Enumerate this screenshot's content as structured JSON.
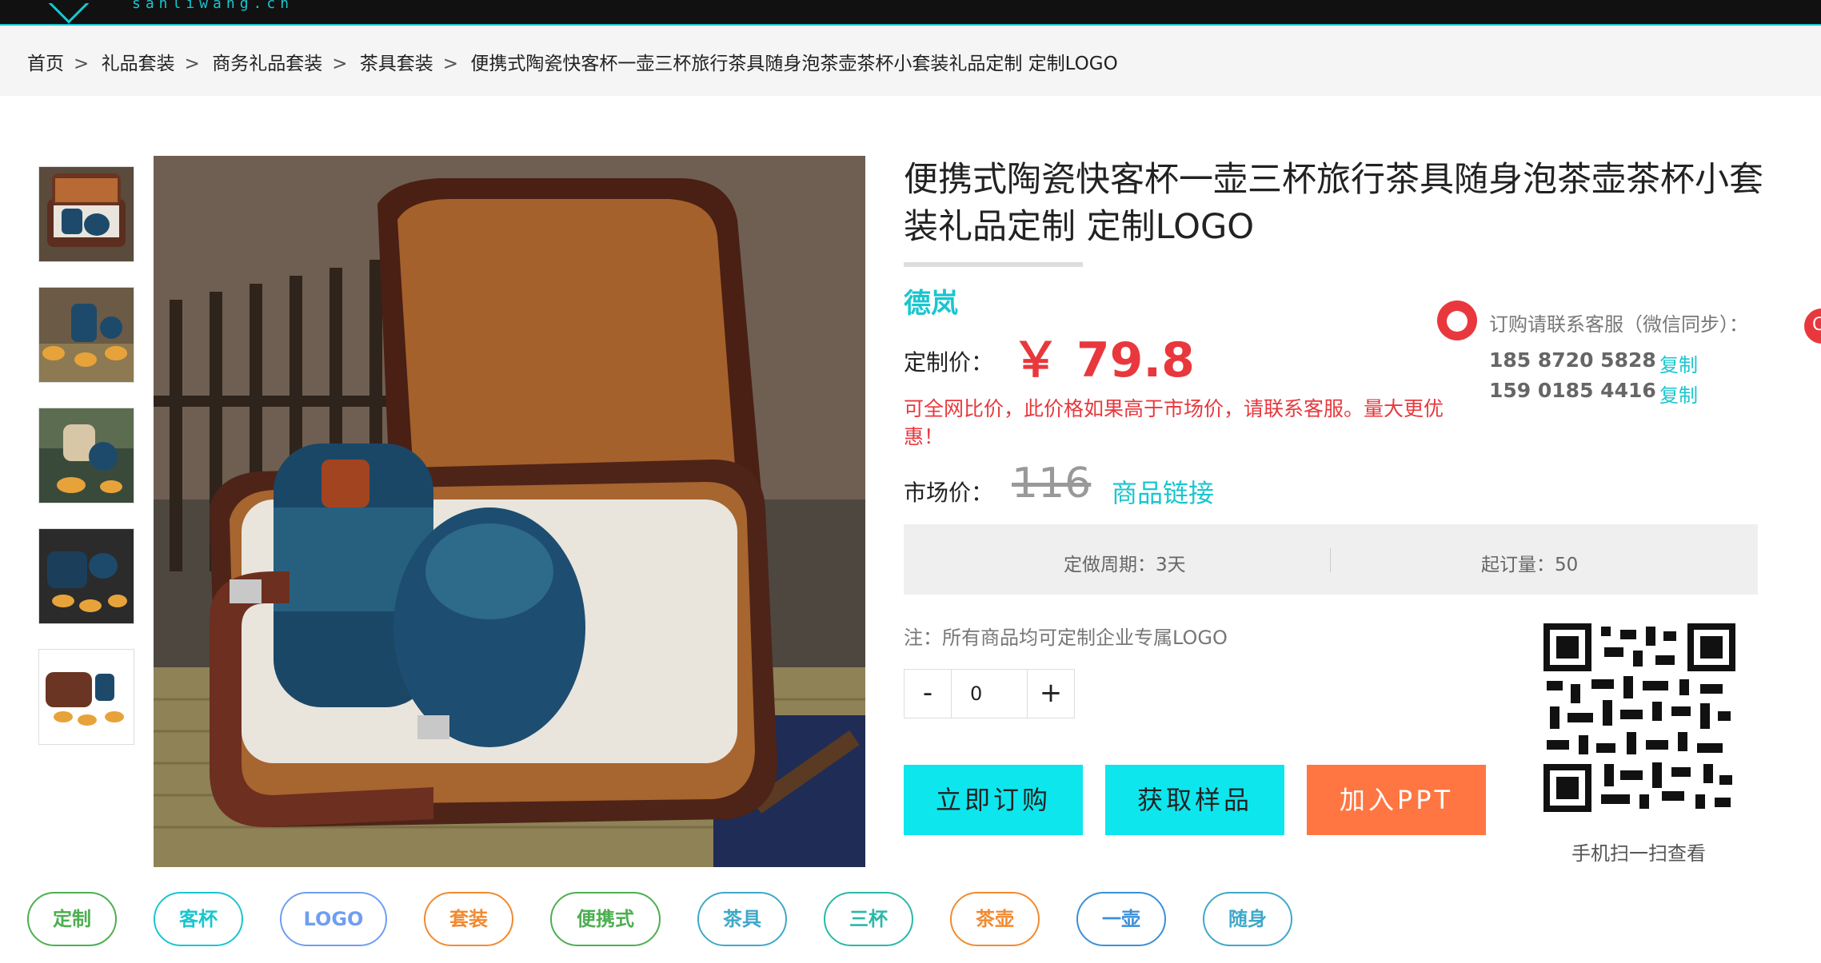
{
  "site": {
    "logo_sub": "sanliwang.cn"
  },
  "breadcrumb": {
    "items": [
      "首页",
      "礼品套装",
      "商务礼品套装",
      "茶具套装",
      "便携式陶瓷快客杯一壶三杯旅行茶具随身泡茶壶茶杯小套装礼品定制 定制LOGO"
    ],
    "separator": ">"
  },
  "product": {
    "title": "便携式陶瓷快客杯一壶三杯旅行茶具随身泡茶壶茶杯小套装礼品定制 定制LOGO",
    "brand": "德岚",
    "price_label": "定制价：",
    "price": "￥ 79.8",
    "price_note": "可全网比价，此价格如果高于市场价，请联系客服。量大更优惠！",
    "market_label": "市场价：",
    "market_price": "116",
    "product_link": "商品链接",
    "spec_cycle": "定做周期：3天",
    "spec_moq": "起订量：50",
    "logo_note": "注：所有商品均可定制企业专属LOGO",
    "quantity": "0",
    "minus": "-",
    "plus": "+"
  },
  "service": {
    "text": "订购请联系客服（微信同步）：",
    "phones": [
      "185 8720 5828",
      "159 0185 4416"
    ],
    "copy_label": "复制"
  },
  "buttons": {
    "buy": "立即订购",
    "sample": "获取样品",
    "ppt": "加入PPT"
  },
  "qr": {
    "caption": "手机扫一扫查看"
  },
  "tags": [
    {
      "label": "定制",
      "color": "#4caf50"
    },
    {
      "label": "客杯",
      "color": "#19c6cf"
    },
    {
      "label": "LOGO",
      "color": "#6f9ef2"
    },
    {
      "label": "套装",
      "color": "#f28a30"
    },
    {
      "label": "便携式",
      "color": "#4caf50"
    },
    {
      "label": "茶具",
      "color": "#3fa8c8"
    },
    {
      "label": "三杯",
      "color": "#2bb8a8"
    },
    {
      "label": "茶壶",
      "color": "#f28a30"
    },
    {
      "label": "一壶",
      "color": "#3a8fd8"
    },
    {
      "label": "随身",
      "color": "#3fa8c8"
    }
  ],
  "colors": {
    "accent": "#19c6cf",
    "price_red": "#e8383d",
    "ppt_orange": "#ff7642"
  }
}
